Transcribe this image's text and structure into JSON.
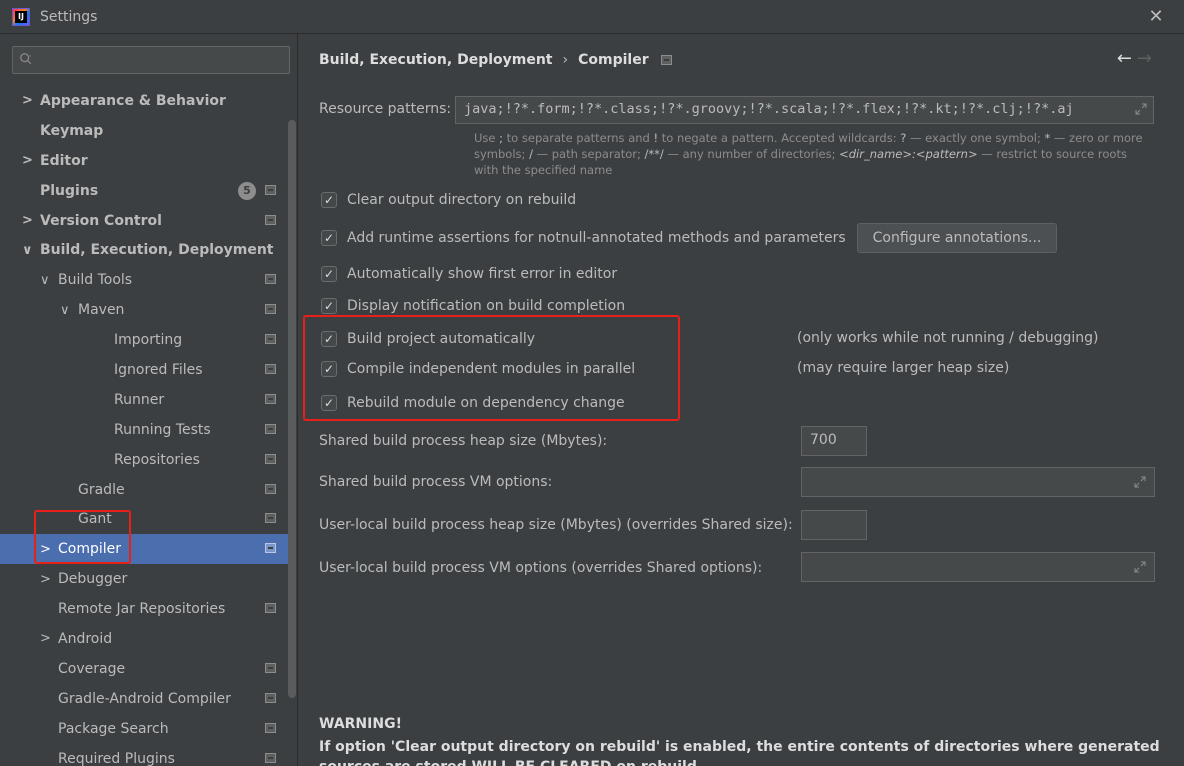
{
  "window": {
    "title": "Settings",
    "app_icon_letter": "IJ"
  },
  "sidebar": {
    "search_placeholder": "",
    "items": [
      {
        "label": "Appearance & Behavior",
        "chevron": ">",
        "bold": true,
        "indent": 0,
        "project_icon": false
      },
      {
        "label": "Keymap",
        "chevron": "",
        "bold": true,
        "indent": 0,
        "project_icon": false
      },
      {
        "label": "Editor",
        "chevron": ">",
        "bold": true,
        "indent": 0,
        "project_icon": false
      },
      {
        "label": "Plugins",
        "chevron": "",
        "bold": true,
        "indent": 0,
        "project_icon": true,
        "badge": "5"
      },
      {
        "label": "Version Control",
        "chevron": ">",
        "bold": true,
        "indent": 0,
        "project_icon": true
      },
      {
        "label": "Build, Execution, Deployment",
        "chevron": "∨",
        "bold": true,
        "indent": 0,
        "project_icon": false
      },
      {
        "label": "Build Tools",
        "chevron": "∨",
        "bold": false,
        "indent": 1,
        "project_icon": true
      },
      {
        "label": "Maven",
        "chevron": "∨",
        "bold": false,
        "indent": 2,
        "project_icon": true
      },
      {
        "label": "Importing",
        "chevron": "",
        "bold": false,
        "indent": 3,
        "project_icon": true
      },
      {
        "label": "Ignored Files",
        "chevron": "",
        "bold": false,
        "indent": 3,
        "project_icon": true
      },
      {
        "label": "Runner",
        "chevron": "",
        "bold": false,
        "indent": 3,
        "project_icon": true
      },
      {
        "label": "Running Tests",
        "chevron": "",
        "bold": false,
        "indent": 3,
        "project_icon": true
      },
      {
        "label": "Repositories",
        "chevron": "",
        "bold": false,
        "indent": 3,
        "project_icon": true
      },
      {
        "label": "Gradle",
        "chevron": "",
        "bold": false,
        "indent": 2,
        "project_icon": true
      },
      {
        "label": "Gant",
        "chevron": "",
        "bold": false,
        "indent": 2,
        "project_icon": true
      },
      {
        "label": "Compiler",
        "chevron": ">",
        "bold": false,
        "indent": 1,
        "project_icon": true,
        "selected": true
      },
      {
        "label": "Debugger",
        "chevron": ">",
        "bold": false,
        "indent": 1,
        "project_icon": false
      },
      {
        "label": "Remote Jar Repositories",
        "chevron": "",
        "bold": false,
        "indent": 1,
        "project_icon": true
      },
      {
        "label": "Android",
        "chevron": ">",
        "bold": false,
        "indent": 1,
        "project_icon": false
      },
      {
        "label": "Coverage",
        "chevron": "",
        "bold": false,
        "indent": 1,
        "project_icon": true
      },
      {
        "label": "Gradle-Android Compiler",
        "chevron": "",
        "bold": false,
        "indent": 1,
        "project_icon": true
      },
      {
        "label": "Package Search",
        "chevron": "",
        "bold": false,
        "indent": 1,
        "project_icon": true
      },
      {
        "label": "Required Plugins",
        "chevron": "",
        "bold": false,
        "indent": 1,
        "project_icon": true
      }
    ]
  },
  "breadcrumb": {
    "parent": "Build, Execution, Deployment",
    "separator": "›",
    "current": "Compiler"
  },
  "nav": {
    "back": "←",
    "forward": "→"
  },
  "resource": {
    "label": "Resource patterns:",
    "value": "java;!?*.form;!?*.class;!?*.groovy;!?*.scala;!?*.flex;!?*.kt;!?*.clj;!?*.aj",
    "hint_parts": [
      "Use ",
      "; ",
      "to separate patterns and ",
      "! ",
      "to negate a pattern. Accepted wildcards: ",
      "? ",
      "— exactly one symbol; ",
      "* ",
      "— zero or more symbols; ",
      "/ ",
      "— path separator; ",
      "/**/ ",
      "— any number of directories; ",
      "<dir_name>:<pattern>",
      " — restrict to source roots with the specified name"
    ]
  },
  "checkboxes": [
    {
      "label": "Clear output directory on rebuild",
      "checked": true
    },
    {
      "label": "Add runtime assertions for notnull-annotated methods and parameters",
      "checked": true
    },
    {
      "label": "Automatically show first error in editor",
      "checked": true
    },
    {
      "label": "Display notification on build completion",
      "checked": true
    },
    {
      "label": "Build project automatically",
      "checked": true,
      "note": "(only works while not running / debugging)"
    },
    {
      "label": "Compile independent modules in parallel",
      "checked": true,
      "note": "(may require larger heap size)"
    },
    {
      "label": "Rebuild module on dependency change",
      "checked": true
    }
  ],
  "configure_button": "Configure annotations...",
  "fields": {
    "shared_heap_label": "Shared build process heap size (Mbytes):",
    "shared_heap_value": "700",
    "shared_vm_label": "Shared build process VM options:",
    "shared_vm_value": "",
    "user_heap_label": "User-local build process heap size (Mbytes) (overrides Shared size):",
    "user_heap_value": "",
    "user_vm_label": "User-local build process VM options (overrides Shared options):",
    "user_vm_value": ""
  },
  "warning": {
    "title": "WARNING!",
    "text": "If option 'Clear output directory on rebuild' is enabled, the entire contents of directories where generated sources are stored WILL BE CLEARED on rebuild."
  },
  "colors": {
    "selection": "#4b6eaf",
    "highlight": "#e8201a",
    "background": "#3c3f41"
  }
}
